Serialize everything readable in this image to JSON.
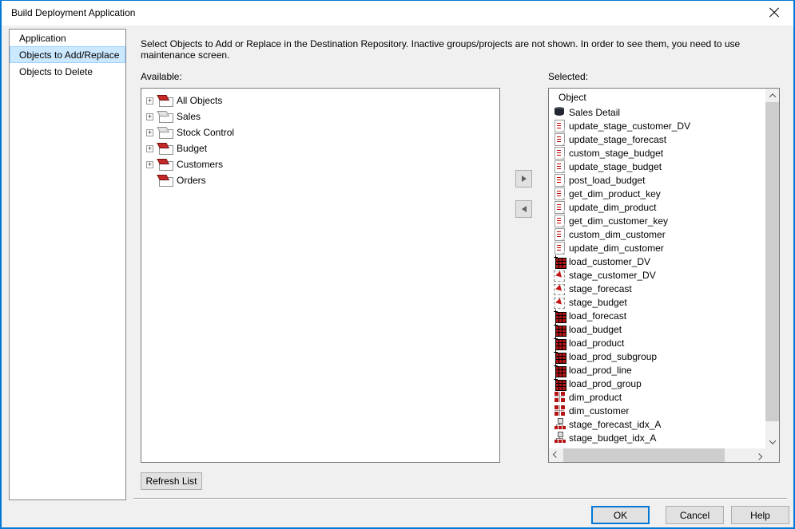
{
  "window": {
    "title": "Build Deployment Application"
  },
  "instruction": "Select Objects to Add or Replace in the Destination Repository. Inactive groups/projects are not shown. In order to see them, you need to use maintenance screen.",
  "sidebar": {
    "items": [
      {
        "label": "Application",
        "state": "normal"
      },
      {
        "label": "Objects to Add/Replace",
        "state": "selected"
      },
      {
        "label": "Objects to Delete",
        "state": "normal"
      }
    ]
  },
  "available": {
    "label": "Available:",
    "tree": [
      {
        "label": "All Objects",
        "expander": "+",
        "folder": "red-folder"
      },
      {
        "label": "Sales",
        "expander": "+",
        "folder": "gray-folder"
      },
      {
        "label": "Stock Control",
        "expander": "+",
        "folder": "gray-folder"
      },
      {
        "label": "Budget",
        "expander": "+",
        "folder": "red-folder"
      },
      {
        "label": "Customers",
        "expander": "+",
        "folder": "red-folder"
      },
      {
        "label": "Orders",
        "expander": "",
        "folder": "red-folder"
      }
    ]
  },
  "transfer": {
    "add_icon": "triangle-right",
    "remove_icon": "triangle-left"
  },
  "selected": {
    "label": "Selected:",
    "column_header": "Object",
    "items": [
      {
        "label": "Sales Detail",
        "icon": "fact"
      },
      {
        "label": "update_stage_customer_DV",
        "icon": "proc"
      },
      {
        "label": "update_stage_forecast",
        "icon": "proc"
      },
      {
        "label": "custom_stage_budget",
        "icon": "proc"
      },
      {
        "label": "update_stage_budget",
        "icon": "proc"
      },
      {
        "label": "post_load_budget",
        "icon": "proc"
      },
      {
        "label": "get_dim_product_key",
        "icon": "proc"
      },
      {
        "label": "update_dim_product",
        "icon": "proc"
      },
      {
        "label": "get_dim_customer_key",
        "icon": "proc"
      },
      {
        "label": "custom_dim_customer",
        "icon": "proc"
      },
      {
        "label": "update_dim_customer",
        "icon": "proc"
      },
      {
        "label": "load_customer_DV",
        "icon": "load"
      },
      {
        "label": "stage_customer_DV",
        "icon": "stage"
      },
      {
        "label": "stage_forecast",
        "icon": "stage"
      },
      {
        "label": "stage_budget",
        "icon": "stage"
      },
      {
        "label": "load_forecast",
        "icon": "load"
      },
      {
        "label": "load_budget",
        "icon": "load"
      },
      {
        "label": "load_product",
        "icon": "load"
      },
      {
        "label": "load_prod_subgroup",
        "icon": "load"
      },
      {
        "label": "load_prod_line",
        "icon": "load"
      },
      {
        "label": "load_prod_group",
        "icon": "load"
      },
      {
        "label": "dim_product",
        "icon": "dim"
      },
      {
        "label": "dim_customer",
        "icon": "dim"
      },
      {
        "label": "stage_forecast_idx_A",
        "icon": "idx"
      },
      {
        "label": "stage_budget_idx_A",
        "icon": "idx"
      }
    ]
  },
  "buttons": {
    "refresh": "Refresh List",
    "ok": "OK",
    "cancel": "Cancel",
    "help": "Help"
  },
  "colors": {
    "accent": "#0078d7",
    "selection_bg": "#cce8ff",
    "selection_border": "#99d1ff",
    "object_red": "#b41414",
    "dialog_bg": "#f0f0f0"
  }
}
